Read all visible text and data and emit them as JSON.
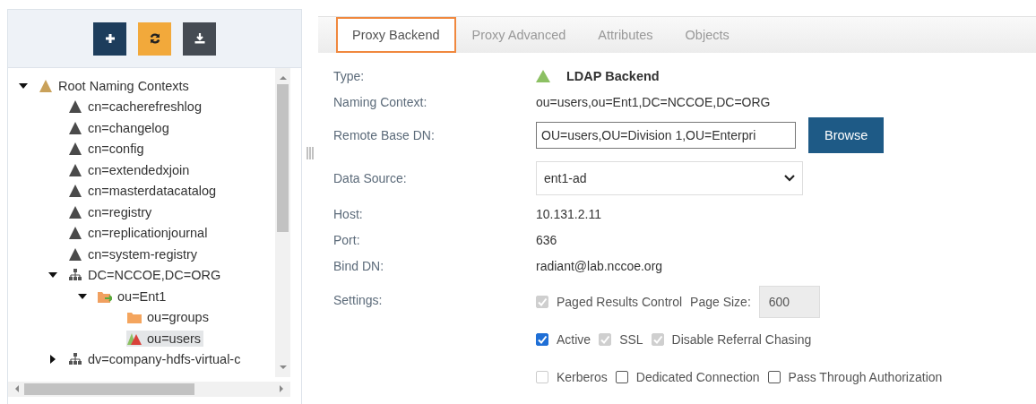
{
  "toolbar": [
    {
      "kind": "add"
    },
    {
      "kind": "refresh"
    },
    {
      "kind": "download"
    }
  ],
  "tree": [
    {
      "label": "Root Naming Contexts",
      "kind": "root",
      "expanded": true,
      "selected": false,
      "children": [
        {
          "label": "cn=cacherefreshlog",
          "kind": "naming",
          "selected": false
        },
        {
          "label": "cn=changelog",
          "kind": "naming",
          "selected": false
        },
        {
          "label": "cn=config",
          "kind": "naming",
          "selected": false
        },
        {
          "label": "cn=extendedxjoin",
          "kind": "naming",
          "selected": false
        },
        {
          "label": "cn=masterdatacatalog",
          "kind": "naming",
          "selected": false
        },
        {
          "label": "cn=registry",
          "kind": "naming",
          "selected": false
        },
        {
          "label": "cn=replicationjournal",
          "kind": "naming",
          "selected": false
        },
        {
          "label": "cn=system-registry",
          "kind": "naming",
          "selected": false
        },
        {
          "label": "DC=NCCOE,DC=ORG",
          "kind": "hierarchy",
          "expanded": true,
          "selected": false,
          "children": [
            {
              "label": "ou=Ent1",
              "kind": "folder-link",
              "expanded": true,
              "selected": false,
              "children": [
                {
                  "label": "ou=groups",
                  "kind": "folder",
                  "selected": false
                },
                {
                  "label": "ou=users",
                  "kind": "backend",
                  "selected": true
                }
              ]
            }
          ]
        },
        {
          "label": "dv=company-hdfs-virtual-c",
          "kind": "hierarchy",
          "expanded": false,
          "selected": false
        }
      ]
    }
  ],
  "tabs": [
    {
      "label": "Proxy Backend",
      "selected": true
    },
    {
      "label": "Proxy Advanced",
      "selected": false
    },
    {
      "label": "Attributes",
      "selected": false
    },
    {
      "label": "Objects",
      "selected": false
    }
  ],
  "fields": [
    {
      "label": "Type:",
      "kind": "type",
      "value": "LDAP Backend"
    },
    {
      "label": "Naming Context:",
      "kind": "text",
      "value": "ou=users,ou=Ent1,DC=NCCOE,DC=ORG"
    },
    {
      "label": "Remote Base DN:",
      "kind": "input",
      "value": "OU=users,OU=Division 1,OU=Enterpri",
      "button": "Browse"
    },
    {
      "label": "Data Source:",
      "kind": "select",
      "value": "ent1-ad"
    },
    {
      "label": "Host:",
      "kind": "text",
      "value": "10.131.2.11"
    },
    {
      "label": "Port:",
      "kind": "text",
      "value": "636"
    },
    {
      "label": "Bind DN:",
      "kind": "text",
      "value": "radiant@lab.nccoe.org"
    },
    {
      "label": "Settings:",
      "kind": "settings",
      "lines": [
        [
          {
            "kind": "checkbox",
            "label": "Paged Results Control",
            "checked": true,
            "disabled": true
          },
          {
            "kind": "number",
            "label": "Page Size:",
            "value": "600",
            "disabled": true
          }
        ],
        [
          {
            "kind": "checkbox",
            "label": "Active",
            "checked": true,
            "disabled": false
          },
          {
            "kind": "checkbox",
            "label": "SSL",
            "checked": true,
            "disabled": true
          },
          {
            "kind": "checkbox",
            "label": "Disable Referral Chasing",
            "checked": true,
            "disabled": true
          }
        ],
        [
          {
            "kind": "checkbox",
            "label": "Kerberos",
            "checked": false,
            "disabled": true
          },
          {
            "kind": "checkbox",
            "label": "Dedicated Connection",
            "checked": false,
            "disabled": false
          },
          {
            "kind": "checkbox",
            "label": "Pass Through Authorization",
            "checked": false,
            "disabled": false
          }
        ]
      ]
    }
  ]
}
